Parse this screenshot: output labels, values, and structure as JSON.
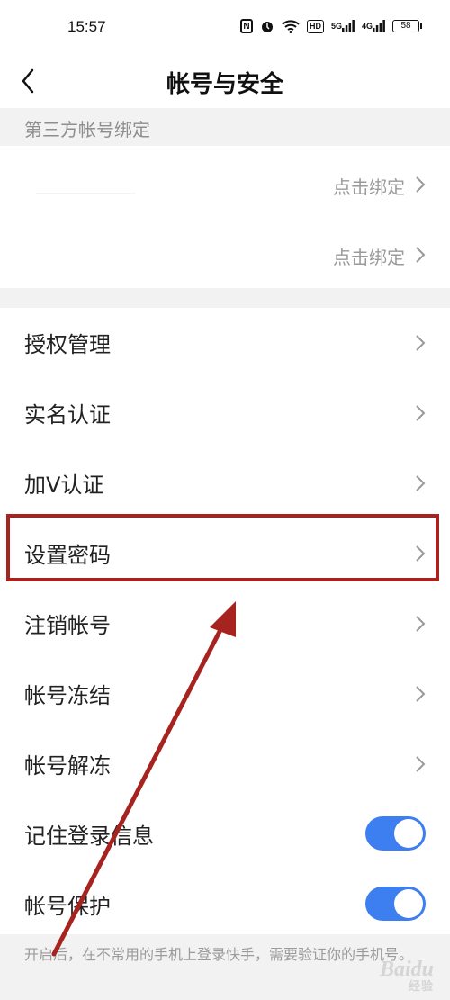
{
  "status_bar": {
    "time": "15:57",
    "signal_1": "5G",
    "signal_2": "4G",
    "battery": "58"
  },
  "nav": {
    "title": "帐号与安全"
  },
  "third_party": {
    "header": "第三方帐号绑定",
    "rows": [
      {
        "action": "点击绑定"
      },
      {
        "action": "点击绑定"
      }
    ]
  },
  "menu": {
    "items": [
      {
        "label": "授权管理"
      },
      {
        "label": "实名认证"
      },
      {
        "label": "加V认证"
      },
      {
        "label": "设置密码"
      },
      {
        "label": "注销帐号"
      },
      {
        "label": "帐号冻结"
      },
      {
        "label": "帐号解冻"
      }
    ],
    "toggles": [
      {
        "label": "记住登录信息",
        "on": true
      },
      {
        "label": "帐号保护",
        "on": true
      }
    ]
  },
  "footer_note": "开启后，在不常用的手机上登录快手，需要验证你的手机号。",
  "watermark": {
    "brand": "Baidu",
    "sub": "经验"
  },
  "colors": {
    "accent_toggle": "#3d7ef0",
    "annotation_red": "#a6231f"
  }
}
